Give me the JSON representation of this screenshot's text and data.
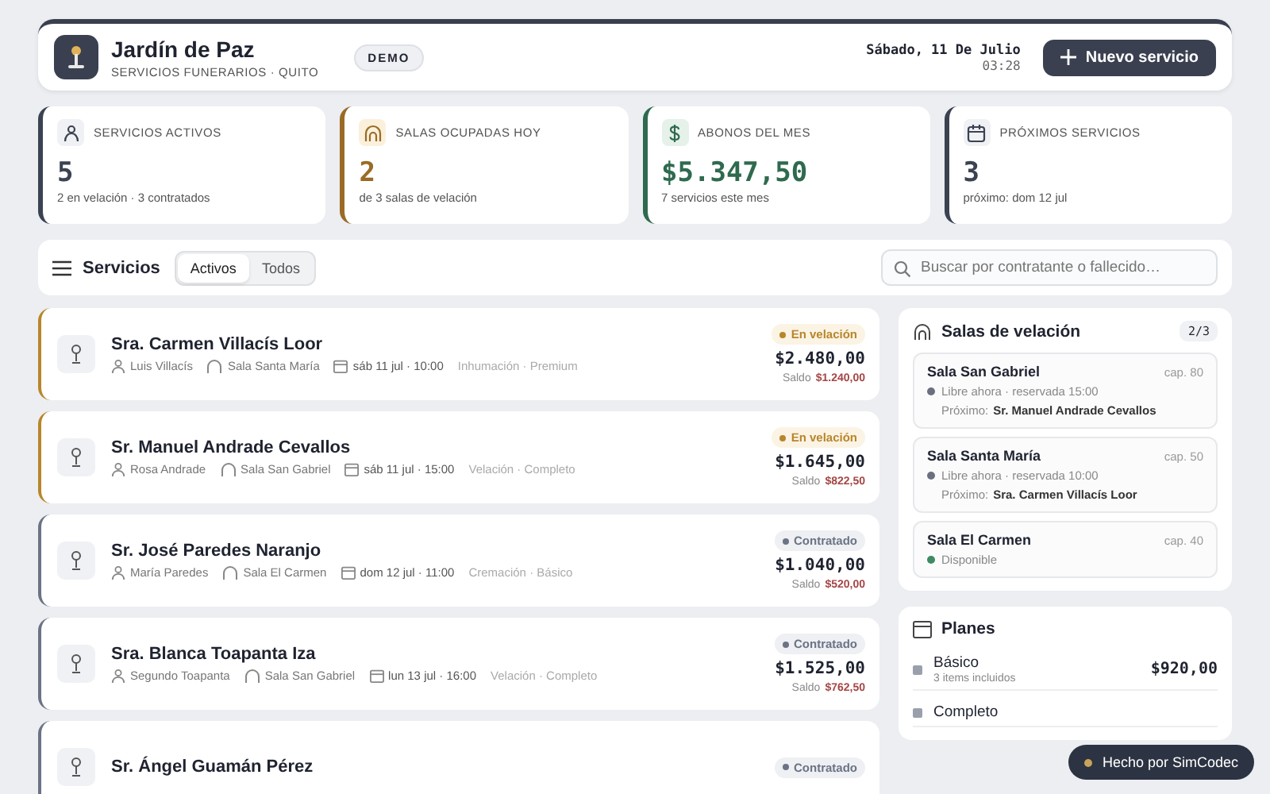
{
  "header": {
    "brand": "Jardín de Paz",
    "subtitle": "SERVICIOS FUNERARIOS · QUITO",
    "badge": "DEMO",
    "date": "Sábado, 11 De Julio",
    "time": "03:28",
    "button": "Nuevo servicio"
  },
  "stats": [
    {
      "kind": "person",
      "label": "SERVICIOS ACTIVOS",
      "value": "5",
      "note": "2 en velación · 3 contratados",
      "color": "#3b4252"
    },
    {
      "kind": "arch",
      "label": "SALAS OCUPADAS HOY",
      "value": "2",
      "note": "de 3 salas de velación",
      "color": "#9a6b25"
    },
    {
      "kind": "dollar",
      "label": "ABONOS DEL MES",
      "value": "$5.347,50",
      "note": "7 servicios este mes",
      "color": "#2f6a4f"
    },
    {
      "kind": "calendar",
      "label": "PRÓXIMOS SERVICIOS",
      "value": "3",
      "note": "próximo: dom 12 jul",
      "color": "#3b4252"
    }
  ],
  "toolbar": {
    "title": "Servicios",
    "tabs": [
      {
        "label": "Activos",
        "selected": true
      },
      {
        "label": "Todos",
        "selected": false
      }
    ],
    "search": {
      "placeholder": "Buscar por contratante o fallecido…"
    }
  },
  "services": [
    {
      "name": "Sra. Carmen Villacís Loor",
      "contact": "Luis Villacís",
      "room": "Sala Santa María",
      "date": "sáb 11 jul · 10:00",
      "plan": "Inhumación · Premium",
      "kind": "velacion",
      "status_label": "En velación",
      "amount": "$2.480,00",
      "balance_label": "Saldo",
      "balance": "$1.240,00"
    },
    {
      "name": "Sr. Manuel Andrade Cevallos",
      "contact": "Rosa Andrade",
      "room": "Sala San Gabriel",
      "date": "sáb 11 jul · 15:00",
      "plan": "Velación · Completo",
      "kind": "velacion",
      "status_label": "En velación",
      "amount": "$1.645,00",
      "balance_label": "Saldo",
      "balance": "$822,50"
    },
    {
      "name": "Sr. José Paredes Naranjo",
      "contact": "María Paredes",
      "room": "Sala El Carmen",
      "date": "dom 12 jul · 11:00",
      "plan": "Cremación · Básico",
      "kind": "contratado",
      "status_label": "Contratado",
      "amount": "$1.040,00",
      "balance_label": "Saldo",
      "balance": "$520,00"
    },
    {
      "name": "Sra. Blanca Toapanta Iza",
      "contact": "Segundo Toapanta",
      "room": "Sala San Gabriel",
      "date": "lun 13 jul · 16:00",
      "plan": "Velación · Completo",
      "kind": "contratado",
      "status_label": "Contratado",
      "amount": "$1.525,00",
      "balance_label": "Saldo",
      "balance": "$762,50"
    },
    {
      "name": "Sr. Ángel Guamán Pérez",
      "kind": "contratado",
      "status_label": "Contratado"
    }
  ],
  "rooms": {
    "title": "Salas de velación",
    "count": "2/3",
    "items": [
      {
        "name": "Sala San Gabriel",
        "capacity": "cap. 80",
        "state": "Libre ahora · reservada 15:00",
        "color": "#6b7080",
        "next_label": "Próximo:",
        "next": "Sr. Manuel Andrade Cevallos"
      },
      {
        "name": "Sala Santa María",
        "capacity": "cap. 50",
        "state": "Libre ahora · reservada 10:00",
        "color": "#6b7080",
        "next_label": "Próximo:",
        "next": "Sra. Carmen Villacís Loor"
      },
      {
        "name": "Sala El Carmen",
        "capacity": "cap. 40",
        "state": "Disponible",
        "color": "#3d8a63"
      }
    ]
  },
  "plans": {
    "title": "Planes",
    "items": [
      {
        "name": "Básico",
        "note": "3 items incluidos",
        "price": "$920,00"
      },
      {
        "name": "Completo"
      }
    ]
  },
  "toast": "Hecho por SimCodec"
}
